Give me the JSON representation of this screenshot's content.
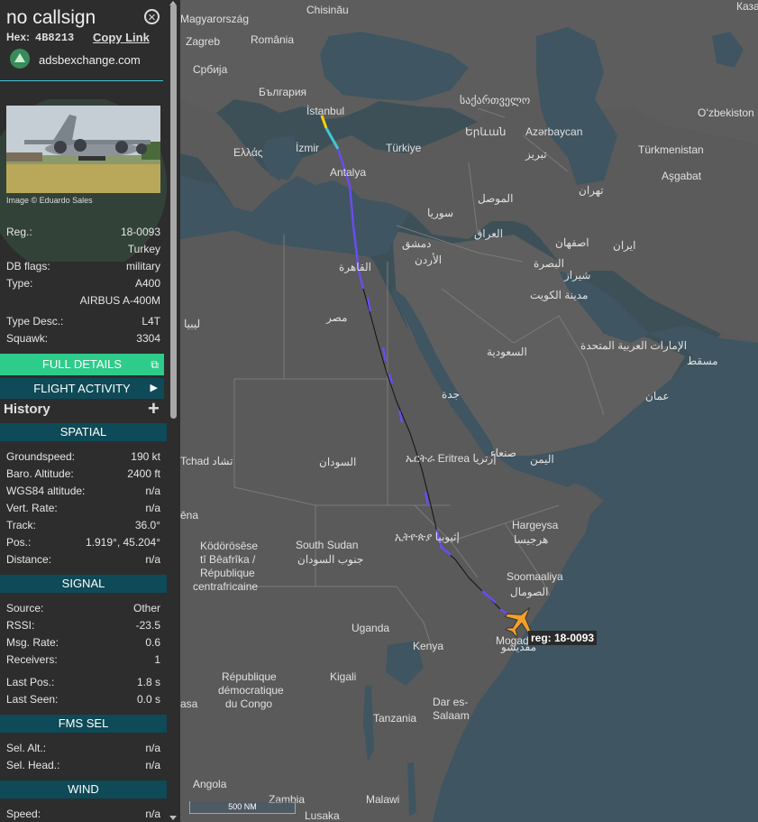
{
  "aircraft": {
    "callsign": "no callsign",
    "hex_label": "Hex:",
    "hex": "4B8213",
    "copy_link": "Copy Link",
    "source_site": "adsbexchange.com",
    "photo_credit": "Image © Eduardo Sales",
    "registration": "18-0093",
    "country": "Turkey",
    "db_flags": "military",
    "type_code": "A400",
    "type_name": "AIRBUS A-400M",
    "type_desc": "L4T",
    "squawk": "3304"
  },
  "labels": {
    "reg": "Reg.:",
    "db_flags": "DB flags:",
    "type": "Type:",
    "type_desc": "Type Desc.:",
    "squawk": "Squawk:",
    "full_details": "FULL DETAILS",
    "flight_activity": "FLIGHT ACTIVITY",
    "history": "History"
  },
  "spatial": {
    "title": "SPATIAL",
    "rows": [
      {
        "k": "Groundspeed:",
        "v": "190 kt"
      },
      {
        "k": "Baro. Altitude:",
        "v": "2400 ft"
      },
      {
        "k": "WGS84 altitude:",
        "v": "n/a"
      },
      {
        "k": "Vert. Rate:",
        "v": "n/a"
      },
      {
        "k": "Track:",
        "v": "36.0°"
      },
      {
        "k": "Pos.:",
        "v": "1.919°, 45.204°"
      },
      {
        "k": "Distance:",
        "v": "n/a"
      }
    ]
  },
  "signal": {
    "title": "SIGNAL",
    "rows": [
      {
        "k": "Source:",
        "v": "Other"
      },
      {
        "k": "RSSI:",
        "v": "-23.5"
      },
      {
        "k": "Msg. Rate:",
        "v": "0.6"
      },
      {
        "k": "Receivers:",
        "v": "1"
      },
      {
        "k": "Last Pos.:",
        "v": "1.8 s"
      },
      {
        "k": "Last Seen:",
        "v": "0.0 s"
      }
    ]
  },
  "fms": {
    "title": "FMS SEL",
    "rows": [
      {
        "k": "Sel. Alt.:",
        "v": "n/a"
      },
      {
        "k": "Sel. Head.:",
        "v": "n/a"
      }
    ]
  },
  "wind": {
    "title": "WIND",
    "rows": [
      {
        "k": "Speed:",
        "v": "n/a"
      }
    ]
  },
  "map": {
    "aircraft_label": "reg: 18-0093",
    "scale": "500 NM",
    "places": {
      "chisinau": "Chisinău",
      "kaza": "Каза",
      "magyarorszag": "Magyarország",
      "zagreb": "Zagreb",
      "romania": "România",
      "srbija": "Србија",
      "bulgaria": "България",
      "istanbul": "İstanbul",
      "georgia": "საქართველო",
      "ozbekiston": "Oʻzbekiston",
      "armenia": "Երևան",
      "azerbaycan": "Azərbaycan",
      "izmir": "İzmir",
      "turkiye": "Türkiye",
      "tabriz": "تبریز",
      "turkmenistan": "Türkmenistan",
      "ellas": "Ελλάς",
      "antalya": "Antalya",
      "asgabat": "Aşgabat",
      "mosul": "الموصل",
      "tehran": "تهران",
      "syria": "سوريا",
      "iraq": "العراق",
      "isfahan": "اصفهان",
      "iran": "ایران",
      "damascus": "دمشق",
      "jordan": "الأردن",
      "basra": "البصرة",
      "shiraz": "شیراز",
      "cairo": "القاهرة",
      "kuwait": "مدينة الكويت",
      "libya": "ليبيا",
      "egypt": "مصر",
      "uae": "الإمارات العربية المتحدة",
      "saudi": "السعودية",
      "muscat": "مسقط",
      "jeddah": "جدة",
      "oman": "عمان",
      "chad": "Tchad تشاد",
      "sudan": "السودان",
      "eritrea": "ኤርትራ Eritrea إرتريا",
      "sanaa": "صنعاء",
      "yemen": "اليمن",
      "ena": "ēna",
      "hargeysa": "Hargeysa",
      "hargeysa_ar": "هرجيسا",
      "kodorosese": "Ködörösêse",
      "beafrika": "tî Bêafrîka /",
      "republique_ca": "République",
      "centrafricaine": "centrafricaine",
      "south_sudan": "South Sudan",
      "south_sudan_ar": "جنوب السودان",
      "ethiopia": "ኢትዮጵያ إثيوبيا",
      "soomaaliya": "Soomaaliya",
      "somalia_ar": "الصومال",
      "uganda": "Uganda",
      "kenya": "Kenya",
      "mogadishu": "Mogadisho",
      "mogadishu_ar": "مقديشو",
      "kigali": "Kigali",
      "rdc1": "République",
      "rdc2": "démocratique",
      "rdc3": "du Congo",
      "dar1": "Dar es-",
      "dar2": "Salaam",
      "tanzania": "Tanzania",
      "asa": "asa",
      "angola": "Angola",
      "zambia": "Zambia",
      "malawi": "Malawi",
      "lusaka": "Lusaka"
    }
  }
}
